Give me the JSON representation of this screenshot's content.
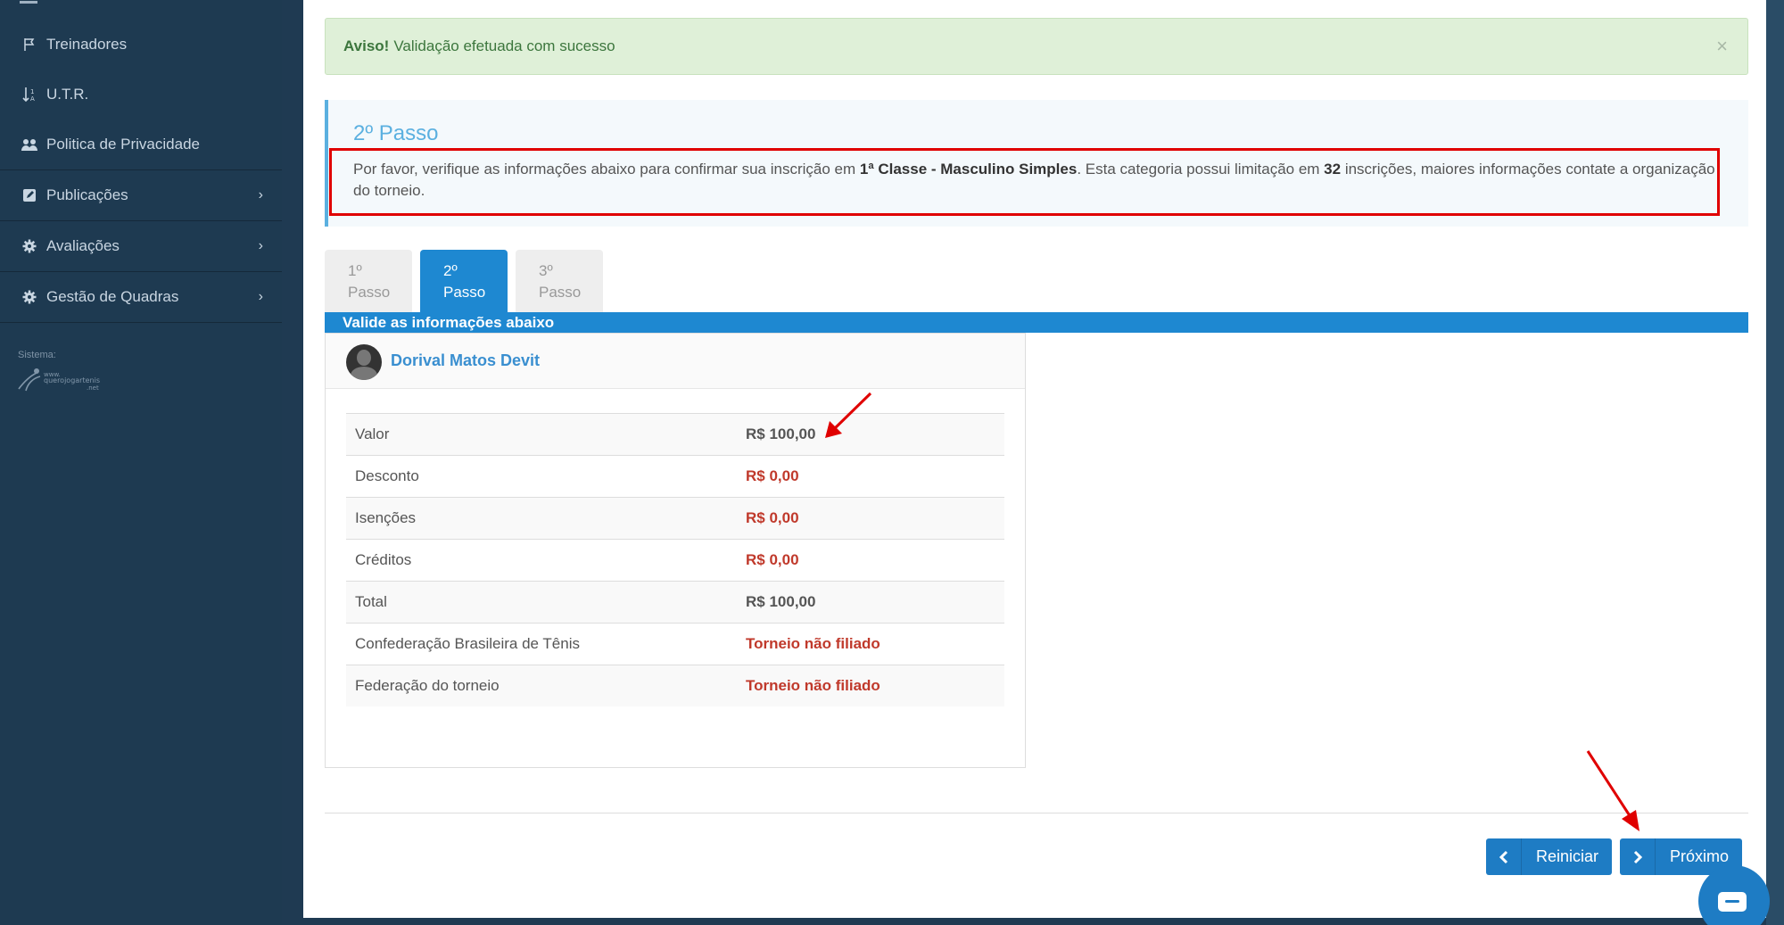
{
  "sidebar": {
    "items": [
      {
        "label": "Treinadores",
        "icon": "flag-icon"
      },
      {
        "label": "U.T.R.",
        "icon": "sort-icon"
      },
      {
        "label": "Politica de Privacidade",
        "icon": "users-icon"
      },
      {
        "label": "Publicações",
        "icon": "edit-icon",
        "chevron": "›"
      },
      {
        "label": "Avaliações",
        "icon": "gear-icon",
        "chevron": "›"
      },
      {
        "label": "Gestão de Quadras",
        "icon": "gear-icon",
        "chevron": "›"
      }
    ],
    "system_label": "Sistema:",
    "logo_text": "www.querojogartenis.net"
  },
  "alert": {
    "strong": "Aviso!",
    "message": "Validação efetuada com sucesso",
    "close": "×"
  },
  "info": {
    "title": "2º Passo",
    "text_1": "Por favor, verifique as informações abaixo para confirmar sua inscrição em ",
    "category": "1ª Classe - Masculino Simples",
    "text_2": ". Esta categoria possui limitação em ",
    "limit": "32",
    "text_3": " inscrições, maiores informações contate a organização do torneio."
  },
  "tabs": [
    {
      "line1": "1º",
      "line2": "Passo"
    },
    {
      "line1": "2º",
      "line2": "Passo"
    },
    {
      "line1": "3º",
      "line2": "Passo"
    }
  ],
  "wizard": {
    "title": "Valide as informações abaixo"
  },
  "card": {
    "player_name": "Dorival Matos Devit",
    "rows": [
      {
        "label": "Valor",
        "value": "R$ 100,00"
      },
      {
        "label": "Desconto",
        "value": "R$ 0,00"
      },
      {
        "label": "Isenções",
        "value": "R$ 0,00"
      },
      {
        "label": "Créditos",
        "value": "R$ 0,00"
      },
      {
        "label": "Total",
        "value": "R$ 100,00"
      },
      {
        "label": "Confederação Brasileira de Tênis",
        "value": "Torneio não filiado"
      },
      {
        "label": "Federação do torneio",
        "value": "Torneio não filiado"
      }
    ]
  },
  "buttons": {
    "reiniciar": "Reiniciar",
    "proximo": "Próximo"
  },
  "colors": {
    "sidebar": "#1e3a51",
    "accent": "#1e88d1",
    "alert_bg": "#dff0d8",
    "danger": "#c0392b",
    "annotation": "#e00000"
  }
}
